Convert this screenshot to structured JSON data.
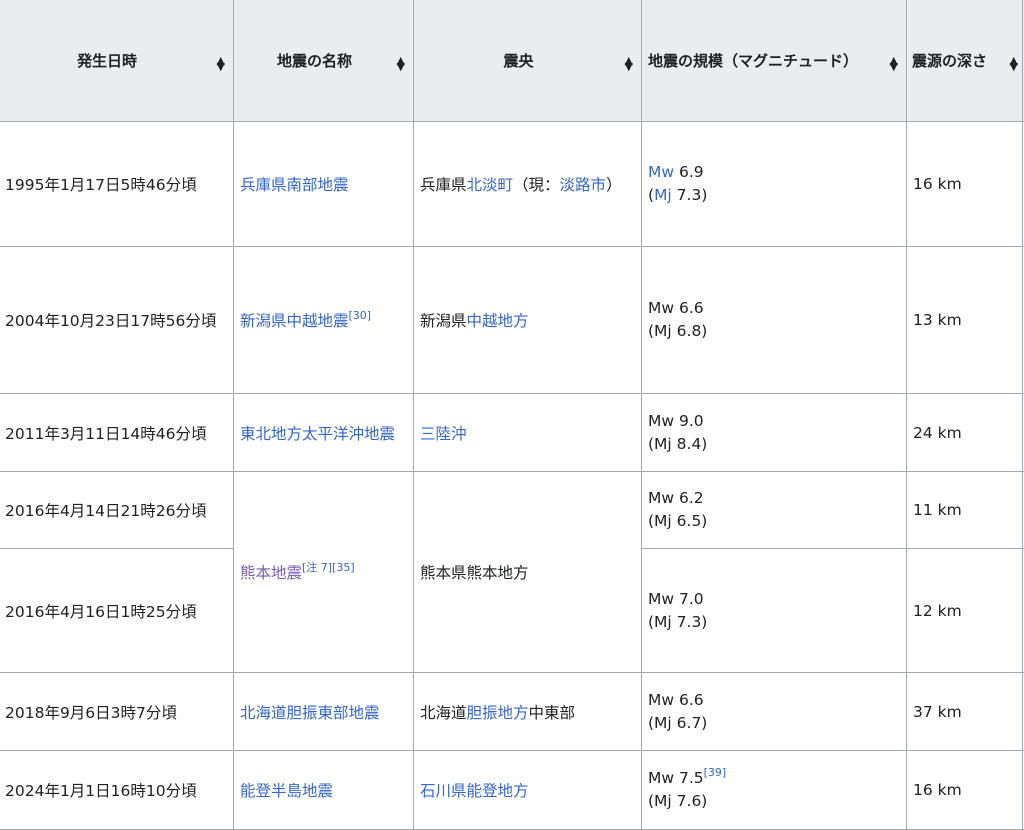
{
  "headers": [
    "発生日時",
    "地震の名称",
    "震央",
    "地震の規模（マグニチュード）",
    "震源の深さ"
  ],
  "rows": [
    {
      "date": "1995年1月17日5時46分頃",
      "name": "兵庫県南部地震",
      "name_note": "",
      "epi_pre": "兵庫県",
      "epi_link": "北淡町",
      "epi_mid": "（現：",
      "epi_link2": "淡路市",
      "epi_post": "）",
      "mw_prefix": "Mw",
      "mw": " 6.9",
      "mw_note": "",
      "mj_open": "(",
      "mj_prefix": "Mj",
      "mj": " 7.3)",
      "depth": "16 km"
    },
    {
      "date": "2004年10月23日17時56分頃",
      "name": "新潟県中越地震",
      "name_note": "[30]",
      "epi_pre": "新潟県",
      "epi_link": "中越地方",
      "epi_mid": "",
      "epi_link2": "",
      "epi_post": "",
      "mw_text": "Mw 6.6",
      "mw_note": "",
      "mj_text": "(Mj 6.8)",
      "depth": "13 km"
    },
    {
      "date": "2011年3月11日14時46分頃",
      "name": "東北地方太平洋沖地震",
      "name_note": "",
      "epi_pre": "",
      "epi_link": "三陸沖",
      "epi_mid": "",
      "epi_link2": "",
      "epi_post": "",
      "mw_text": "Mw 9.0",
      "mw_note": "",
      "mj_text": "(Mj 8.4)",
      "depth": "24 km"
    },
    {
      "date": "2016年4月14日21時26分頃",
      "name": "熊本地震",
      "name_note": "[注 7][35]",
      "epi_text": "熊本県熊本地方",
      "mw_text": "Mw 6.2",
      "mw_note": "",
      "mj_text": "(Mj 6.5)",
      "depth": "11 km"
    },
    {
      "date": "2016年4月16日1時25分頃",
      "mw_text": "Mw 7.0",
      "mw_note": "",
      "mj_text": "(Mj 7.3)",
      "depth": "12 km"
    },
    {
      "date": "2018年9月6日3時7分頃",
      "name": "北海道胆振東部地震",
      "name_note": "",
      "epi_pre": "北海道",
      "epi_link": "胆振地方",
      "epi_mid": "中東部",
      "epi_link2": "",
      "epi_post": "",
      "mw_text": "Mw 6.6",
      "mw_note": "",
      "mj_text": "(Mj 6.7)",
      "depth": "37 km"
    },
    {
      "date": "2024年1月1日16時10分頃",
      "name": "能登半島地震",
      "name_note": "",
      "epi_pre": "",
      "epi_link": "石川県能登地方",
      "epi_mid": "",
      "epi_link2": "",
      "epi_post": "",
      "mw_text": "Mw 7.5",
      "mw_note": "[39]",
      "mj_text": "(Mj 7.6)",
      "depth": "16 km"
    }
  ],
  "colors": {
    "link": "#3366cc",
    "visited_link": "#795cb2",
    "header_bg": "#eaecf0",
    "border": "#a2a9b1"
  }
}
